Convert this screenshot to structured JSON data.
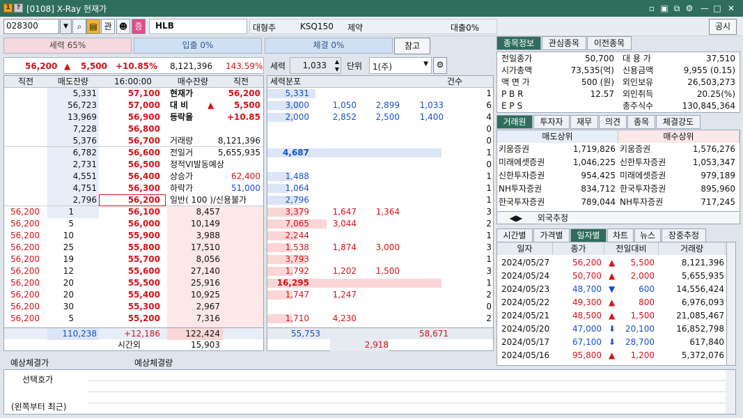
{
  "window": {
    "title": "[0108] X-Ray 현재가",
    "badge1": "1",
    "badge2": "?"
  },
  "toolbar": {
    "code": "028300",
    "btn_gwan": "관",
    "btn_jeung": "증",
    "name": "HLB",
    "info1": "대형주",
    "info2": "KSQ150",
    "info3": "제약",
    "loan": "대출0%",
    "gongsi": "공시"
  },
  "bars": {
    "seryeok": "세력 65%",
    "ipchul": "입출 0%",
    "chegyeol": "체결 0%",
    "ref": "참고"
  },
  "pricebar": {
    "price": "56,200",
    "arrow": "▲",
    "change": "5,500",
    "rate": "+10.85%",
    "volume": "8,121,396",
    "ratio": "143.59%"
  },
  "controls": {
    "seryeok_label": "세력",
    "seryeok_val": "1,033",
    "unit_label": "단위",
    "unit_val": "1(주)"
  },
  "orderbook": {
    "headers": {
      "a": "직전",
      "b": "매도잔량",
      "time": "16:00:00",
      "c": "매수잔량",
      "d": "직전"
    },
    "sell": [
      {
        "qty": "5,331",
        "price": "57,100",
        "lbl": "현재가",
        "val": "56,200"
      },
      {
        "qty": "56,723",
        "price": "57,000",
        "lbl": "대 비",
        "val": "5,500",
        "mark": "▲"
      },
      {
        "qty": "13,969",
        "price": "56,900",
        "lbl": "등락율",
        "val": "+10.85"
      },
      {
        "qty": "7,228",
        "price": "56,800",
        "lbl": "",
        "val": ""
      },
      {
        "qty": "5,376",
        "price": "56,700",
        "lbl": "거래량",
        "val": "8,121,396"
      },
      {
        "qty": "6,782",
        "price": "56,600",
        "lbl": "전일거",
        "val": "5,655,935"
      },
      {
        "qty": "2,731",
        "price": "56,500",
        "lbl": "정적VI발동예상",
        "val": ""
      },
      {
        "qty": "4,551",
        "price": "56,400",
        "lbl": "상승가",
        "val": "62,400"
      },
      {
        "qty": "4,751",
        "price": "56,300",
        "lbl": "하락가",
        "val": "51,000"
      },
      {
        "qty": "2,796",
        "price": "56,200",
        "lbl": "일반( 100 )/신용불가",
        "val": ""
      }
    ],
    "buy": [
      {
        "prev": "56,200",
        "cnt": "1",
        "price": "56,100",
        "qty": "8,457"
      },
      {
        "prev": "56,200",
        "cnt": "5",
        "price": "56,000",
        "qty": "10,149"
      },
      {
        "prev": "56,200",
        "cnt": "10",
        "price": "55,900",
        "qty": "3,988"
      },
      {
        "prev": "56,200",
        "cnt": "25",
        "price": "55,800",
        "qty": "17,510"
      },
      {
        "prev": "56,200",
        "cnt": "19",
        "price": "55,700",
        "qty": "8,056"
      },
      {
        "prev": "56,200",
        "cnt": "12",
        "price": "55,600",
        "qty": "27,140"
      },
      {
        "prev": "56,200",
        "cnt": "20",
        "price": "55,500",
        "qty": "25,916"
      },
      {
        "prev": "56,200",
        "cnt": "20",
        "price": "55,400",
        "qty": "10,925"
      },
      {
        "prev": "56,200",
        "cnt": "30",
        "price": "55,300",
        "qty": "2,967"
      },
      {
        "prev": "56,200",
        "cnt": "5",
        "price": "55,200",
        "qty": "7,316"
      }
    ],
    "total_sell": "110,238",
    "total_diff": "+12,186",
    "total_buy": "122,424",
    "after_label": "시간외",
    "after_val": "15,903"
  },
  "middle": {
    "header": "세력분포",
    "header2": "건수",
    "rows": [
      [
        "5,331",
        "",
        "",
        "",
        "1"
      ],
      [
        "3,000",
        "1,050",
        "2,899",
        "1,033",
        "6"
      ],
      [
        "2,000",
        "2,852",
        "2,500",
        "1,400",
        "4"
      ],
      [
        "",
        "",
        "",
        "",
        "0"
      ],
      [
        "",
        "",
        "",
        "",
        "0"
      ],
      [
        "4,687",
        "",
        "",
        "",
        "1"
      ],
      [
        "",
        "",
        "",
        "",
        "0"
      ],
      [
        "1,488",
        "",
        "",
        "",
        "1"
      ],
      [
        "1,064",
        "",
        "",
        "",
        "1"
      ],
      [
        "2,796",
        "",
        "",
        "",
        "1"
      ],
      [
        "3,379",
        "1,647",
        "1,364",
        "",
        "3"
      ],
      [
        "7,065",
        "3,044",
        "",
        "",
        "2"
      ],
      [
        "2,244",
        "",
        "",
        "",
        "1"
      ],
      [
        "1,538",
        "1,874",
        "3,000",
        "",
        "3"
      ],
      [
        "3,793",
        "",
        "",
        "",
        "1"
      ],
      [
        "1,792",
        "1,202",
        "1,500",
        "",
        "3"
      ],
      [
        "16,295",
        "",
        "",
        "",
        "1"
      ],
      [
        "1,747",
        "1,247",
        "",
        "",
        "2"
      ],
      [
        "",
        "",
        "",
        "",
        "0"
      ],
      [
        "1,710",
        "4,230",
        "",
        "",
        "2"
      ]
    ],
    "foot_sell": "55,753",
    "foot_buy": "58,671",
    "foot_diff": "2,918"
  },
  "right": {
    "tabs": [
      "종목정보",
      "관심종목",
      "이전종목"
    ],
    "info_left": [
      [
        "전일종가",
        "50,700"
      ],
      [
        "시가총액",
        "73,535(억)"
      ],
      [
        "액 면 가",
        "500 (원)"
      ],
      [
        "P B R",
        "12.57"
      ],
      [
        "E P S",
        ""
      ]
    ],
    "info_right": [
      [
        "대 용 가",
        "37,510"
      ],
      [
        "신용금액",
        "9,955  (0.15)"
      ],
      [
        "외인보유",
        "26,503,273"
      ],
      [
        "외인취득",
        "20.25(%)"
      ],
      [
        "총주식수",
        "130,845,364"
      ]
    ],
    "tabs2": [
      "거래원",
      "투자자",
      "재무",
      "의견",
      "종목",
      "체결강도"
    ],
    "broker_head": [
      "매도상위",
      "매수상위"
    ],
    "brokers": [
      [
        "키움증권",
        "1,719,826",
        "키움증권",
        "1,576,276"
      ],
      [
        "미래에셋증권",
        "1,046,225",
        "신한투자증권",
        "1,053,347"
      ],
      [
        "신한투자증권",
        "954,425",
        "미래에셋증권",
        "979,189"
      ],
      [
        "NH투자증권",
        "834,712",
        "한국투자증권",
        "895,960"
      ],
      [
        "한국투자증권",
        "789,044",
        "NH투자증권",
        "717,245"
      ]
    ],
    "foreign": "외국추정",
    "tabs3": [
      "시간별",
      "가격별",
      "일자별",
      "차트",
      "뉴스",
      "장중추정"
    ],
    "daily_head": [
      "일자",
      "종가",
      "전일대비",
      "거래량"
    ],
    "daily": [
      [
        "2024/05/27",
        "56,200",
        "▲",
        "5,500",
        "8,121,396",
        "red"
      ],
      [
        "2024/05/24",
        "50,700",
        "▲",
        "2,000",
        "5,655,935",
        "red"
      ],
      [
        "2024/05/23",
        "48,700",
        "▼",
        "600",
        "14,556,424",
        "blue"
      ],
      [
        "2024/05/22",
        "49,300",
        "▲",
        "800",
        "6,976,093",
        "red"
      ],
      [
        "2024/05/21",
        "48,500",
        "▲",
        "1,500",
        "21,085,467",
        "red"
      ],
      [
        "2024/05/20",
        "47,000",
        "⬇",
        "20,100",
        "16,852,798",
        "blue"
      ],
      [
        "2024/05/17",
        "67,100",
        "⬇",
        "28,700",
        "617,840",
        "blue"
      ],
      [
        "2024/05/16",
        "95,800",
        "▲",
        "1,200",
        "5,372,076",
        "red"
      ]
    ]
  },
  "bottom": {
    "exp1": "예상체결가",
    "exp2": "예상체결량",
    "sel1": "선택호가",
    "sel2": "(왼쪽부터 최근)"
  }
}
